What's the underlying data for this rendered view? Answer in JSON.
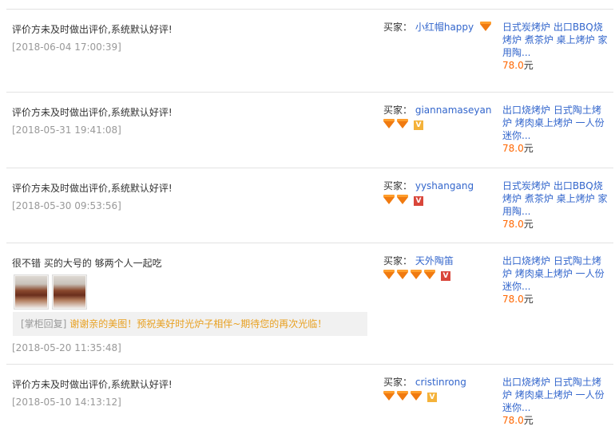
{
  "reviews": [
    {
      "comment": "评价方未及时做出评价,系统默认好评!",
      "date": "[2018-06-04 17:00:39]",
      "buyer_label": "买家：",
      "buyer_name": "小红帽happy",
      "gems": 1,
      "vip": "none",
      "product_title": "日式炭烤炉 出口BBQ烧烤炉 煮茶炉 桌上烤炉 家用陶...",
      "price": "78.0",
      "price_unit": "元"
    },
    {
      "comment": "评价方未及时做出评价,系统默认好评!",
      "date": "[2018-05-31 19:41:08]",
      "buyer_label": "买家：",
      "buyer_name": "giannamaseyan",
      "gems": 2,
      "vip": "gold",
      "product_title": "出口烧烤炉 日式陶土烤炉 烤肉桌上烤炉 一人份迷你...",
      "price": "78.0",
      "price_unit": "元"
    },
    {
      "comment": "评价方未及时做出评价,系统默认好评!",
      "date": "[2018-05-30 09:53:56]",
      "buyer_label": "买家：",
      "buyer_name": "yyshangang",
      "gems": 2,
      "vip": "red",
      "product_title": "日式炭烤炉 出口BBQ烧烤炉 煮茶炉 桌上烤炉 家用陶...",
      "price": "78.0",
      "price_unit": "元"
    },
    {
      "comment": "很不错 买的大号的 够两个人一起吃",
      "date": "[2018-05-20 11:35:48]",
      "buyer_label": "买家：",
      "buyer_name": "天外陶笛",
      "gems": 4,
      "vip": "red",
      "product_title": "出口烧烤炉 日式陶土烤炉 烤肉桌上烤炉 一人份迷你...",
      "price": "78.0",
      "price_unit": "元",
      "reply_label": "[掌柜回复]",
      "reply_text": "谢谢亲的美图！预祝美好时光炉子相伴~期待您的再次光临！"
    },
    {
      "comment": "评价方未及时做出评价,系统默认好评!",
      "date": "[2018-05-10 14:13:12]",
      "buyer_label": "买家：",
      "buyer_name": "cristinrong",
      "gems": 3,
      "vip": "gold",
      "product_title": "出口烧烤炉 日式陶土烤炉 烤肉桌上烤炉 一人份迷你...",
      "price": "78.0",
      "price_unit": "元"
    }
  ]
}
